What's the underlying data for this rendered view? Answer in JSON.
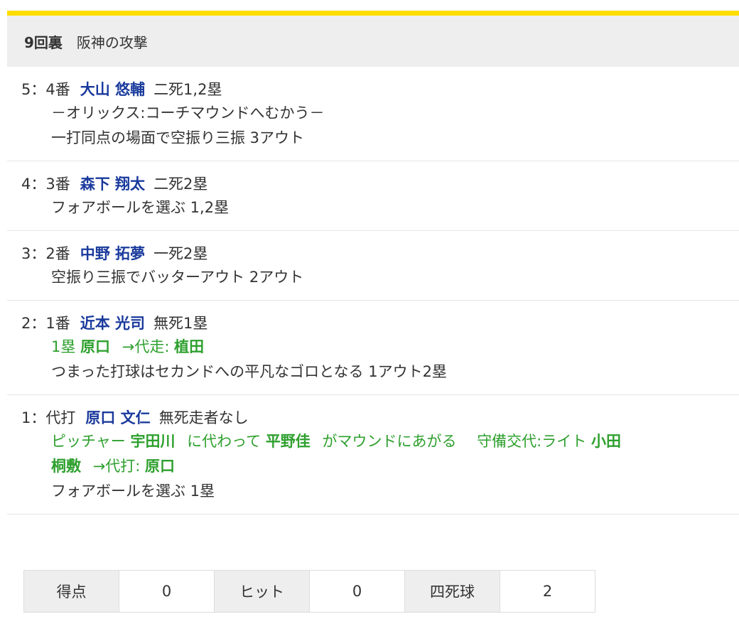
{
  "header": {
    "inning": "9回裏",
    "team_attack": "阪神の攻撃"
  },
  "plays": [
    {
      "num": "5",
      "order": "4番",
      "batter": "大山 悠輔",
      "situation": "二死1,2塁",
      "note": "－オリックス:コーチマウンドへむかう－",
      "result": "一打同点の場面で空振り三振 3アウト"
    },
    {
      "num": "4",
      "order": "3番",
      "batter": "森下 翔太",
      "situation": "二死2塁",
      "result": "フォアボールを選ぶ 1,2塁"
    },
    {
      "num": "3",
      "order": "2番",
      "batter": "中野 拓夢",
      "situation": "一死2塁",
      "result": "空振り三振でバッターアウト 2アウト"
    },
    {
      "num": "2",
      "order": "1番",
      "batter": "近本 光司",
      "situation": "無死1塁",
      "sub": {
        "base": "1塁",
        "runner": "原口",
        "change": "→代走:",
        "new_runner": "植田"
      },
      "result": "つまった打球はセカンドへの平凡なゴロとなる 1アウト2塁"
    },
    {
      "num": "1",
      "order": "代打",
      "batter": "原口 文仁",
      "situation": "無死走者なし",
      "sub": {
        "pitcher_label": "ピッチャー",
        "old_pitcher": "宇田川",
        "replaced_text": "に代わって",
        "new_pitcher": "平野佳",
        "mound_text": "がマウンドにあがる",
        "defense_text": "守備交代:ライト",
        "fielder_line1": "小田",
        "fielder_line2": "桐敷",
        "ph_text": "→代打:",
        "ph_name": "原口"
      },
      "result": "フォアボールを選ぶ 1塁"
    }
  ],
  "summary": {
    "runs_label": "得点",
    "runs": "0",
    "hits_label": "ヒット",
    "hits": "0",
    "walks_label": "四死球",
    "walks": "2"
  },
  "colors": {
    "accent": "#ffdd00",
    "batter": "#1a3a9c",
    "substitution": "#2ea02e",
    "header_bg": "#eeeeee"
  }
}
